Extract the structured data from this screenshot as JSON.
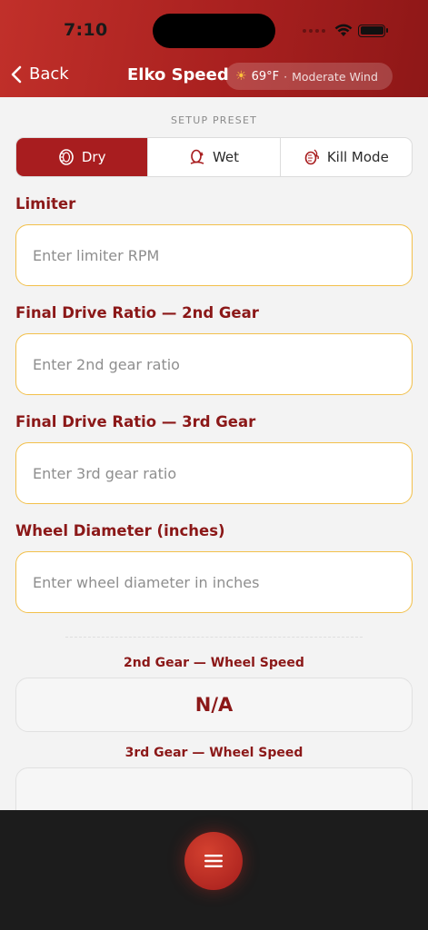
{
  "status_bar": {
    "time": "7:10"
  },
  "nav": {
    "back_label": "Back",
    "title": "Elko Speed",
    "weather": {
      "temperature": "69°F",
      "separator": "·",
      "condition": "Moderate Wind"
    }
  },
  "preset": {
    "title": "SETUP PRESET",
    "options": [
      {
        "label": "Dry",
        "selected": true
      },
      {
        "label": "Wet",
        "selected": false
      },
      {
        "label": "Kill Mode",
        "selected": false
      }
    ]
  },
  "fields": [
    {
      "label": "Limiter",
      "placeholder": "Enter limiter RPM",
      "value": ""
    },
    {
      "label": "Final Drive Ratio — 2nd Gear",
      "placeholder": "Enter 2nd gear ratio",
      "value": ""
    },
    {
      "label": "Final Drive Ratio — 3rd Gear",
      "placeholder": "Enter 3rd gear ratio",
      "value": ""
    },
    {
      "label": "Wheel Diameter (inches)",
      "placeholder": "Enter wheel diameter in inches",
      "value": ""
    }
  ],
  "results": [
    {
      "label": "2nd Gear — Wheel Speed",
      "value": "N/A"
    },
    {
      "label": "3rd Gear — Wheel Speed",
      "value": ""
    }
  ],
  "colors": {
    "accent": "#a81d1f",
    "input_border": "#f2c04b",
    "label": "#8b1818",
    "bottom_bar": "#1c1c1c"
  }
}
